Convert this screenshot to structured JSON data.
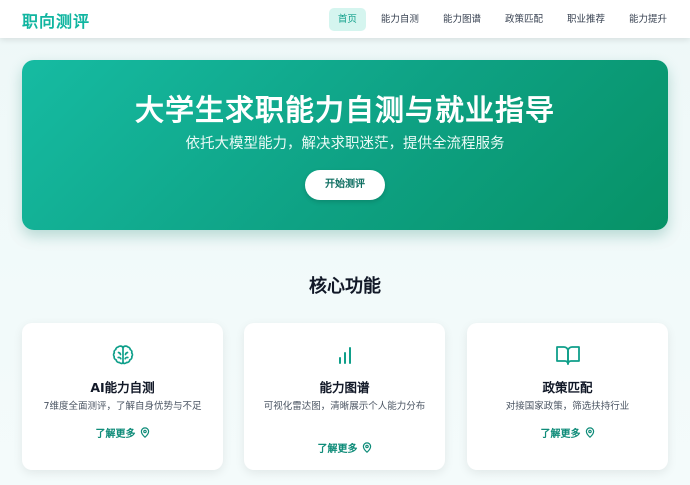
{
  "brand": "职向测评",
  "nav": {
    "items": [
      {
        "label": "首页",
        "active": true
      },
      {
        "label": "能力自测",
        "active": false
      },
      {
        "label": "能力图谱",
        "active": false
      },
      {
        "label": "政策匹配",
        "active": false
      },
      {
        "label": "职业推荐",
        "active": false
      },
      {
        "label": "能力提升",
        "active": false
      }
    ]
  },
  "hero": {
    "title": "大学生求职能力自测与就业指导",
    "subtitle": "依托大模型能力，解决求职迷茫，提供全流程服务",
    "button": "开始测评"
  },
  "features": {
    "title": "核心功能",
    "cards": [
      {
        "icon": "brain-icon",
        "title": "AI能力自测",
        "desc": "7维度全面测评，了解自身优势与不足",
        "link": "了解更多"
      },
      {
        "icon": "bar-chart-icon",
        "title": "能力图谱",
        "desc": "可视化雷达图，清晰展示个人能力分布",
        "link": "了解更多"
      },
      {
        "icon": "book-open-icon",
        "title": "政策匹配",
        "desc": "对接国家政策，筛选扶持行业",
        "link": "了解更多"
      }
    ]
  },
  "colors": {
    "accent": "#10b5a0",
    "hero_start": "#16bba2",
    "hero_end": "#079266"
  }
}
